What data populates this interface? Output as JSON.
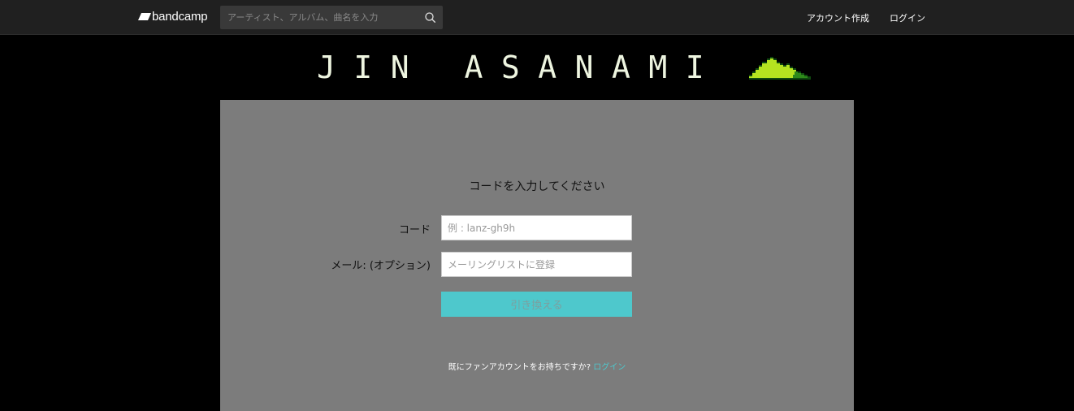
{
  "topbar": {
    "logo_text": "bandcamp",
    "search_placeholder": "アーティスト、アルバム、曲名を入力",
    "signup_label": "アカウント作成",
    "login_label": "ログイン"
  },
  "header": {
    "artist_name": "JIN ASANAMI"
  },
  "redeem_form": {
    "title": "コードを入力してください",
    "code_label": "コード",
    "code_placeholder": "例 : lanz-gh9h",
    "email_label": "メール: (オプション)",
    "email_placeholder": "メーリングリストに登録",
    "submit_label": "引き換える",
    "existing_account_text": "既にファンアカウントをお持ちですか?",
    "existing_account_link": "ログイン"
  },
  "colors": {
    "topbar_bg": "#202020",
    "page_bg": "#000000",
    "panel_bg": "#7c7c7c",
    "accent": "#4ec8cc",
    "mountain_green": "#b5e320"
  },
  "icons": {
    "logo": "bandcamp-logo-icon",
    "search": "search-icon",
    "header_art": "pixel-mountain-icon"
  }
}
